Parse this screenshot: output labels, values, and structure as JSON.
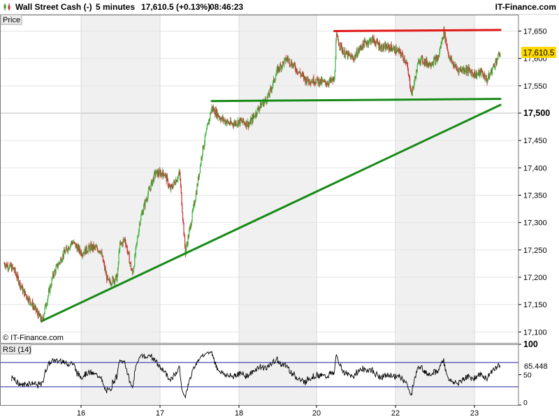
{
  "header": {
    "instrument": "Wall Street Cash (-)",
    "timeframe": "5 minutes",
    "quote": "17,610.5 (+0.13%)",
    "time": "08:46:23",
    "brand": "IT-Finance.com"
  },
  "price_tab": "Price",
  "watermark": "© IT-Finance.com",
  "colors": {
    "candle_up": "#3cb43c",
    "candle_down": "#c83232",
    "support": "#168a16",
    "resistance": "#e01818",
    "last_price_bg": "#ffd800",
    "rsi_line": "#000000",
    "rsi_levels": "#2020a0",
    "shade": "#f0f0f0"
  },
  "chart_data": [
    {
      "type": "candlestick",
      "title": "Wall Street Cash (-)",
      "ylim": [
        17080,
        17680
      ],
      "y_ticks": [
        "17,100",
        "17,150",
        "17,200",
        "17,250",
        "17,300",
        "17,350",
        "17,400",
        "17,450",
        "17,500",
        "17,550",
        "17,600",
        "17,650"
      ],
      "y_tick_values": [
        17100,
        17150,
        17200,
        17250,
        17300,
        17350,
        17400,
        17450,
        17500,
        17550,
        17600,
        17650
      ],
      "major_tick": "17,500",
      "last_price": 17610.5,
      "last_price_label": "17,610.5",
      "grid": true,
      "x_tick_labels": [
        "16",
        "17",
        "18",
        "20",
        "22",
        "23"
      ],
      "price_path": [
        [
          0,
          17225
        ],
        [
          0.5,
          17215
        ],
        [
          1,
          17175
        ],
        [
          1.5,
          17150
        ],
        [
          2,
          17120
        ],
        [
          2.6,
          17205
        ],
        [
          3.1,
          17240
        ],
        [
          3.6,
          17265
        ],
        [
          4.1,
          17245
        ],
        [
          4.6,
          17255
        ],
        [
          5.1,
          17250
        ],
        [
          5.5,
          17190
        ],
        [
          6,
          17200
        ],
        [
          6.1,
          17255
        ],
        [
          6.4,
          17270
        ],
        [
          6.8,
          17205
        ],
        [
          7.2,
          17305
        ],
        [
          7.5,
          17340
        ],
        [
          8,
          17390
        ],
        [
          8.5,
          17390
        ],
        [
          8.8,
          17360
        ],
        [
          9.3,
          17390
        ],
        [
          9.6,
          17245
        ],
        [
          9.9,
          17300
        ],
        [
          10.2,
          17360
        ],
        [
          10.5,
          17430
        ],
        [
          11,
          17510
        ],
        [
          11.5,
          17490
        ],
        [
          12,
          17480
        ],
        [
          12.5,
          17485
        ],
        [
          13,
          17480
        ],
        [
          13.5,
          17510
        ],
        [
          14,
          17530
        ],
        [
          14.5,
          17580
        ],
        [
          15,
          17600
        ],
        [
          15.5,
          17580
        ],
        [
          16,
          17560
        ],
        [
          16.5,
          17560
        ],
        [
          17,
          17555
        ],
        [
          17.5,
          17560
        ],
        [
          17.6,
          17640
        ],
        [
          18,
          17610
        ],
        [
          18.5,
          17600
        ],
        [
          19,
          17625
        ],
        [
          19.5,
          17635
        ],
        [
          20,
          17620
        ],
        [
          20.5,
          17620
        ],
        [
          21,
          17610
        ],
        [
          21.3,
          17595
        ],
        [
          21.6,
          17535
        ],
        [
          22,
          17600
        ],
        [
          22.5,
          17590
        ],
        [
          23,
          17600
        ],
        [
          23.3,
          17650
        ],
        [
          23.6,
          17600
        ],
        [
          24,
          17580
        ],
        [
          24.5,
          17580
        ],
        [
          25,
          17570
        ],
        [
          25.3,
          17575
        ],
        [
          25.6,
          17560
        ],
        [
          26,
          17590
        ],
        [
          26.3,
          17610.5
        ]
      ],
      "trendlines": [
        {
          "name": "support",
          "color": "#168a16",
          "points": [
            [
              2,
              17120
            ],
            [
              26.3,
              17515
            ]
          ]
        },
        {
          "name": "support",
          "color": "#168a16",
          "points": [
            [
              11,
              17522
            ],
            [
              26.3,
              17526
            ]
          ]
        },
        {
          "name": "resistance",
          "color": "#e01818",
          "points": [
            [
              17.5,
              17650
            ],
            [
              26.3,
              17652
            ]
          ]
        }
      ]
    },
    {
      "type": "line",
      "title": "RSI (14)",
      "ylim": [
        0,
        100
      ],
      "y_ticks": [
        "0",
        "50",
        "100"
      ],
      "y_tick_values": [
        0,
        50,
        100
      ],
      "levels": [
        70,
        30
      ],
      "last_value": 65.448,
      "last_value_label": "65.448"
    }
  ]
}
